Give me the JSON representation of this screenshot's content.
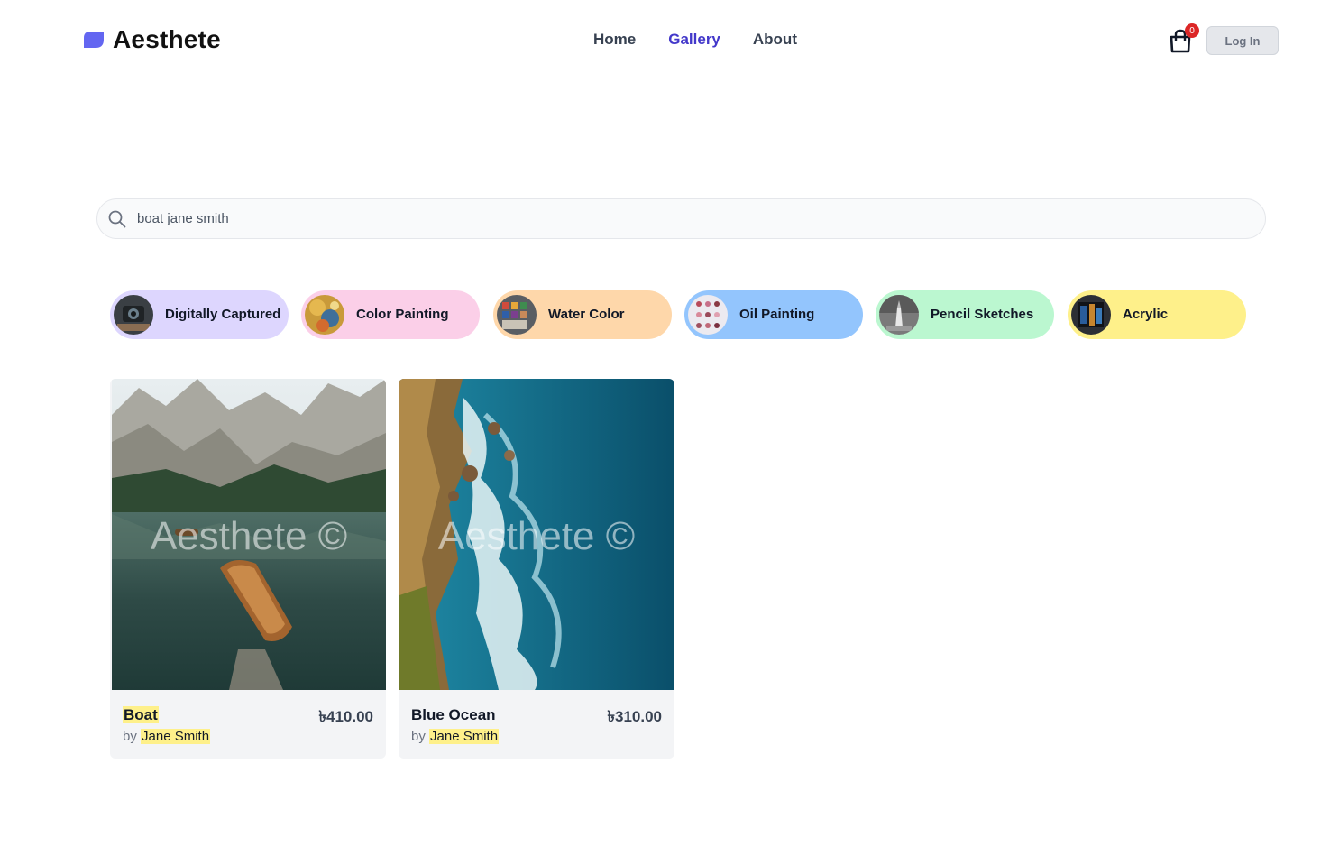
{
  "brand": {
    "name": "Aesthete",
    "accent": "#6366f1"
  },
  "nav": {
    "items": [
      {
        "label": "Home",
        "active": false
      },
      {
        "label": "Gallery",
        "active": true
      },
      {
        "label": "About",
        "active": false
      }
    ]
  },
  "cart": {
    "count": "0",
    "icon": "shopping-bag-icon"
  },
  "auth": {
    "login_label": "Log In"
  },
  "search": {
    "value": "boat jane smith",
    "icon": "search-icon"
  },
  "categories": [
    {
      "label": "Digitally Captured",
      "color": "#ddd6fe"
    },
    {
      "label": "Color Painting",
      "color": "#fbcfe8"
    },
    {
      "label": "Water Color",
      "color": "#fed7aa"
    },
    {
      "label": "Oil Painting",
      "color": "#93c5fd"
    },
    {
      "label": "Pencil Sketches",
      "color": "#bbf7d0"
    },
    {
      "label": "Acrylic",
      "color": "#fef08a"
    }
  ],
  "artworks": [
    {
      "title": "Boat",
      "price": "৳410.00",
      "by": "by",
      "artist": "Jane Smith",
      "watermark": "Aesthete ©",
      "title_highlighted": true
    },
    {
      "title": "Blue Ocean",
      "price": "৳310.00",
      "by": "by",
      "artist": "Jane Smith",
      "watermark": "Aesthete ©",
      "title_highlighted": false
    }
  ],
  "highlight_color": "#fef08a"
}
